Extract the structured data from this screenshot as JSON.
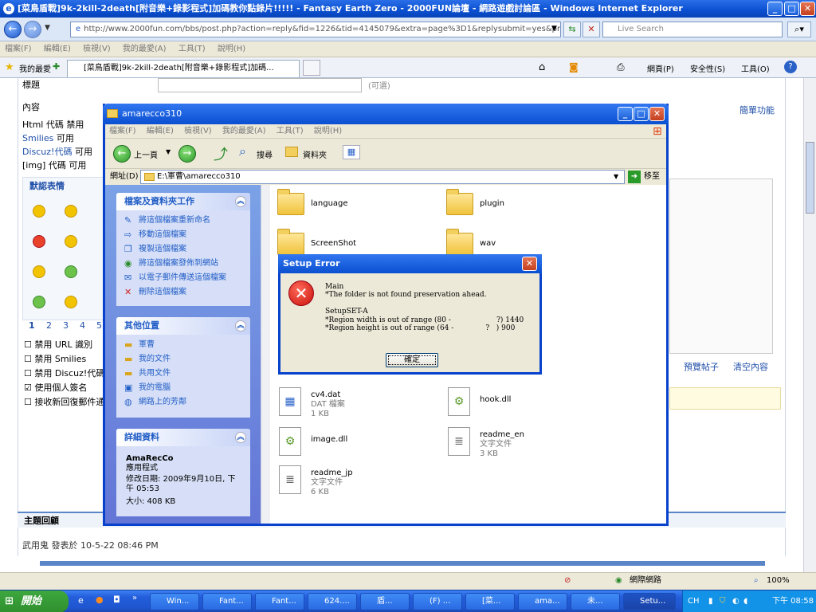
{
  "ie": {
    "title": "[菜鳥盾戰]9k-2kill-2death[附音樂+錄影程式]加碼教你點錄片!!!!! - Fantasy Earth Zero - 2000FUN論壇 - 網路遊戲討論區 - Windows Internet Explorer",
    "url": "http://www.2000fun.com/bbs/post.php?action=reply&fid=1226&tid=4145079&extra=page%3D1&replysubmit=yes&previewpost=yes",
    "search_placeholder": "Live Search",
    "menu": [
      "檔案(F)",
      "編輯(E)",
      "檢視(V)",
      "我的最愛(A)",
      "工具(T)",
      "說明(H)"
    ],
    "favorites_label": "我的最愛",
    "tab_label": "[菜鳥盾戰]9k-2kill-2death[附音樂+錄影程式]加碼...",
    "cmd": [
      "網頁(P)",
      "安全性(S)",
      "工具(O)"
    ],
    "status_zone": "網際網路",
    "zoom": "100%"
  },
  "forum": {
    "subject_label": "標題",
    "subject_hint": "(可選)",
    "content_label": "內容",
    "simple_mode": "簡單功能",
    "html_label": "Html 代碼 禁用",
    "smilies_label_link": "Smilies",
    "smilies_label_tail": " 可用",
    "discuz_link": "Discuz!代碼",
    "discuz_tail": " 可用",
    "img_label": "[img] 代碼 可用",
    "emoji_tab": "默認表情",
    "pages": [
      "1",
      "2",
      "3",
      "4",
      "5"
    ],
    "options": [
      {
        "label": "禁用 URL 識別",
        "checked": false
      },
      {
        "label": "禁用 Smilies",
        "checked": false
      },
      {
        "label": "禁用 Discuz!代碼",
        "checked": false
      },
      {
        "label": "使用個人簽名",
        "checked": true
      },
      {
        "label": "接收新回復郵件通",
        "checked": false
      }
    ],
    "preview_btn": "預覽帖子",
    "clear_btn": "清空內容",
    "reply_header": "主題回顧",
    "reply_meta": "武用鬼 發表於 10-5-22 08:46 PM"
  },
  "explorer": {
    "title": "amarecco310",
    "menu": [
      "檔案(F)",
      "編輯(E)",
      "檢視(V)",
      "我的最愛(A)",
      "工具(T)",
      "說明(H)"
    ],
    "back": "上一頁",
    "search": "搜尋",
    "folders": "資料夾",
    "address_label": "網址(D)",
    "address": "E:\\軍曹\\amarecco310",
    "go": "移至",
    "tasks_header": "檔案及資料夾工作",
    "tasks": [
      "將這個檔案重新命名",
      "移動這個檔案",
      "複製這個檔案",
      "將這個檔案發佈到網站",
      "以電子郵件傳送這個檔案",
      "刪除這個檔案"
    ],
    "places_header": "其他位置",
    "places": [
      "軍曹",
      "我的文件",
      "共用文件",
      "我的電腦",
      "網路上的芳鄰"
    ],
    "details_header": "詳細資料",
    "details_name": "AmaRecCo",
    "details_type": "應用程式",
    "details_date": "修改日期: 2009年9月10日, 下午 05:53",
    "details_size": "大小: 408 KB",
    "files": [
      {
        "name": "language",
        "kind": "folder"
      },
      {
        "name": "plugin",
        "kind": "folder"
      },
      {
        "name": "ScreenShot",
        "kind": "folder"
      },
      {
        "name": "wav",
        "kind": "folder"
      },
      {
        "name": "cv4.dat",
        "type": "DAT 檔案",
        "size": "1 KB",
        "kind": "dat"
      },
      {
        "name": "hook.dll",
        "kind": "dll"
      },
      {
        "name": "image.dll",
        "kind": "dll"
      },
      {
        "name": "readme_en",
        "type": "文字文件",
        "size": "3 KB",
        "kind": "txt"
      },
      {
        "name": "readme_jp",
        "type": "文字文件",
        "size": "6 KB",
        "kind": "txt"
      }
    ]
  },
  "dialog": {
    "title": "Setup Error",
    "line1": "Main",
    "line2": "*The folder is not found preservation ahead.",
    "line3": "SetupSET-A",
    "line4": "*Region width is out of range (80 -                    ?) 1440",
    "line5": "*Region height is out of range (64 -              ?   ) 900",
    "ok": "確定"
  },
  "taskbar": {
    "start": "開始",
    "tasks": [
      "Win...",
      "Fant...",
      "Fant...",
      "624....",
      "盾...",
      "(F) ...",
      "[菜...",
      "ama...",
      "未...",
      "Setu..."
    ],
    "tray_lang": "CH",
    "clock": "下午 08:58"
  }
}
